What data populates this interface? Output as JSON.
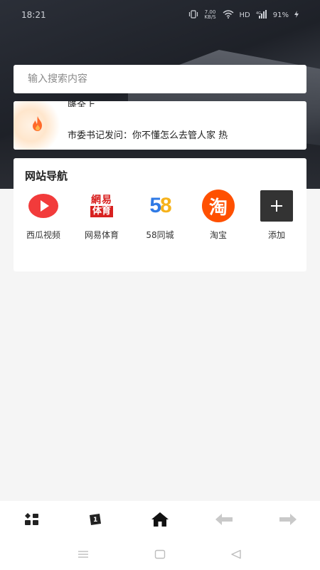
{
  "status_bar": {
    "time": "18:21",
    "network_speed": "7.00 KB/S",
    "hd": "HD",
    "battery": "91%"
  },
  "search": {
    "placeholder": "输入搜索内容"
  },
  "hot_news": {
    "line1": "隆全上",
    "line2": "市委书记发问：你不懂怎么去管人家 热"
  },
  "nav": {
    "title": "网站导航",
    "items": [
      {
        "label": "西瓜视频",
        "icon": "xigua-video-icon"
      },
      {
        "label": "网易体育",
        "icon": "netease-sports-icon",
        "logo_top": "網易",
        "logo_bottom": "体育"
      },
      {
        "label": "58同城",
        "icon": "58-tongcheng-icon",
        "logo_text": "58"
      },
      {
        "label": "淘宝",
        "icon": "taobao-icon",
        "logo_text": "淘"
      },
      {
        "label": "添加",
        "icon": "add-icon"
      }
    ]
  },
  "toolbar": {
    "items": [
      "apps-icon",
      "cards-icon",
      "home-icon",
      "back-arrow-icon",
      "forward-arrow-icon"
    ]
  },
  "colors": {
    "accent_red": "#e53935",
    "taobao_orange": "#ff5000",
    "dark_add": "#333333"
  }
}
